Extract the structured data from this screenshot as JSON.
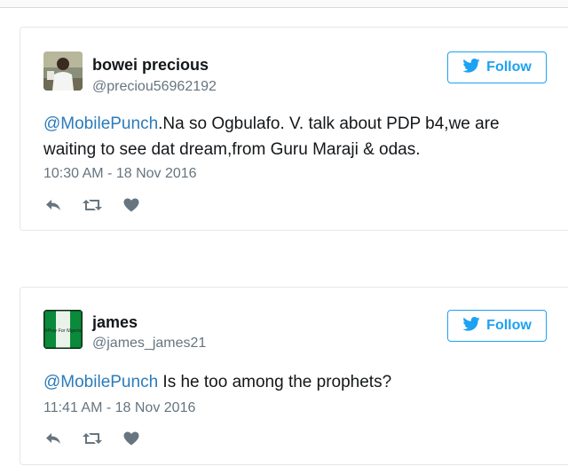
{
  "tweets": [
    {
      "display_name": "bowei precious",
      "screen_name": "@preciou56962192",
      "follow_label": "Follow",
      "mention": "@MobilePunch",
      "text": ".Na so Ogbulafo. V. talk about PDP b4,we are waiting to see dat dream,from Guru Maraji & odas.",
      "timestamp": "10:30 AM - 18 Nov 2016"
    },
    {
      "display_name": "james",
      "screen_name": "@james_james21",
      "follow_label": "Follow",
      "mention": "@MobilePunch",
      "text": " Is he too among the prophets?",
      "timestamp": "11:41 AM - 18 Nov 2016",
      "avatar_text": "#Pray For Nigeria"
    }
  ],
  "colors": {
    "accent": "#1da1f2",
    "mention": "#2b7bb9",
    "secondary_text": "#66757f",
    "nigeria_green": "#0a8a3a"
  },
  "icons": {
    "follow": "bird-icon",
    "reply": "reply-icon",
    "retweet": "retweet-icon",
    "like": "heart-icon"
  }
}
